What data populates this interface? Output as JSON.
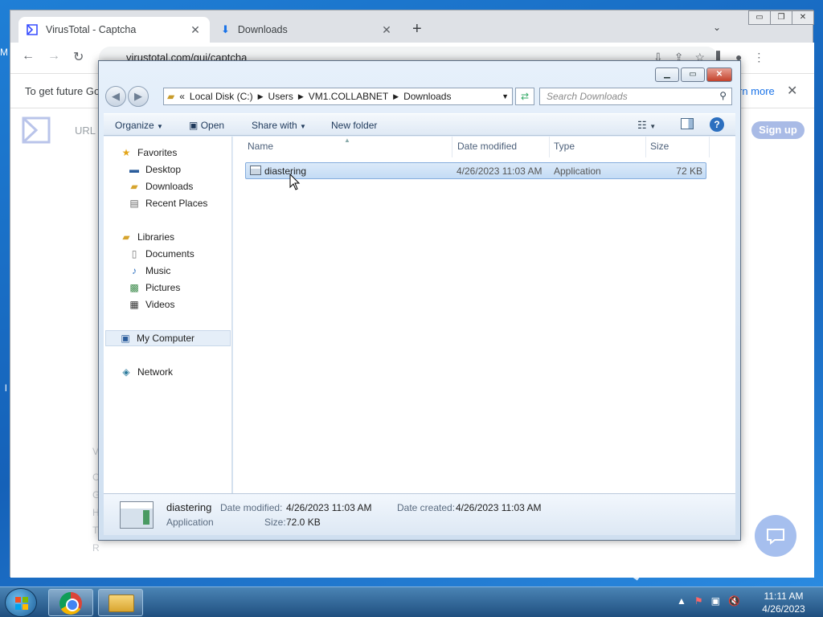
{
  "chrome": {
    "tabs": [
      {
        "title": "VirusTotal - Captcha",
        "active": true
      },
      {
        "title": "Downloads",
        "active": false
      }
    ],
    "new_tab_label": "+",
    "address": "virustotal.com/gui/captcha",
    "infobar": {
      "text": "To get future Go",
      "link": "rn more",
      "close": "✕"
    },
    "page": {
      "url_label": "URL",
      "signup": "Sign up",
      "fragments": [
        "V",
        "C",
        "G",
        "H",
        "T",
        "R"
      ]
    }
  },
  "explorer": {
    "address": {
      "overflow": "«",
      "segments": [
        "Local Disk (C:)",
        "Users",
        "VM1.COLLABNET",
        "Downloads"
      ]
    },
    "search_placeholder": "Search Downloads",
    "commands": {
      "organize": "Organize",
      "open": "Open",
      "share_with": "Share with",
      "new_folder": "New folder"
    },
    "nav": {
      "favorites": "Favorites",
      "desktop": "Desktop",
      "downloads": "Downloads",
      "recent_places": "Recent Places",
      "libraries": "Libraries",
      "documents": "Documents",
      "music": "Music",
      "pictures": "Pictures",
      "videos": "Videos",
      "my_computer": "My Computer",
      "network": "Network"
    },
    "columns": {
      "name": "Name",
      "date_modified": "Date modified",
      "type": "Type",
      "size": "Size"
    },
    "files": [
      {
        "name": "diastering",
        "date_modified": "4/26/2023 11:03 AM",
        "type": "Application",
        "size": "72 KB"
      }
    ],
    "details": {
      "name": "diastering",
      "type": "Application",
      "date_modified_label": "Date modified:",
      "date_modified": "4/26/2023 11:03 AM",
      "date_created_label": "Date created:",
      "date_created": "4/26/2023 11:03 AM",
      "size_label": "Size:",
      "size": "72.0 KB"
    }
  },
  "desktop": {
    "left_text_top": "M",
    "left_text_mid": "l"
  },
  "taskbar": {
    "time": "11:11 AM",
    "date": "4/26/2023"
  },
  "colors": {
    "selection": "#c3dbf5",
    "chrome_frame": "#dee1e6",
    "link": "#1a73e8",
    "signup_bg": "#a9bbe6"
  }
}
